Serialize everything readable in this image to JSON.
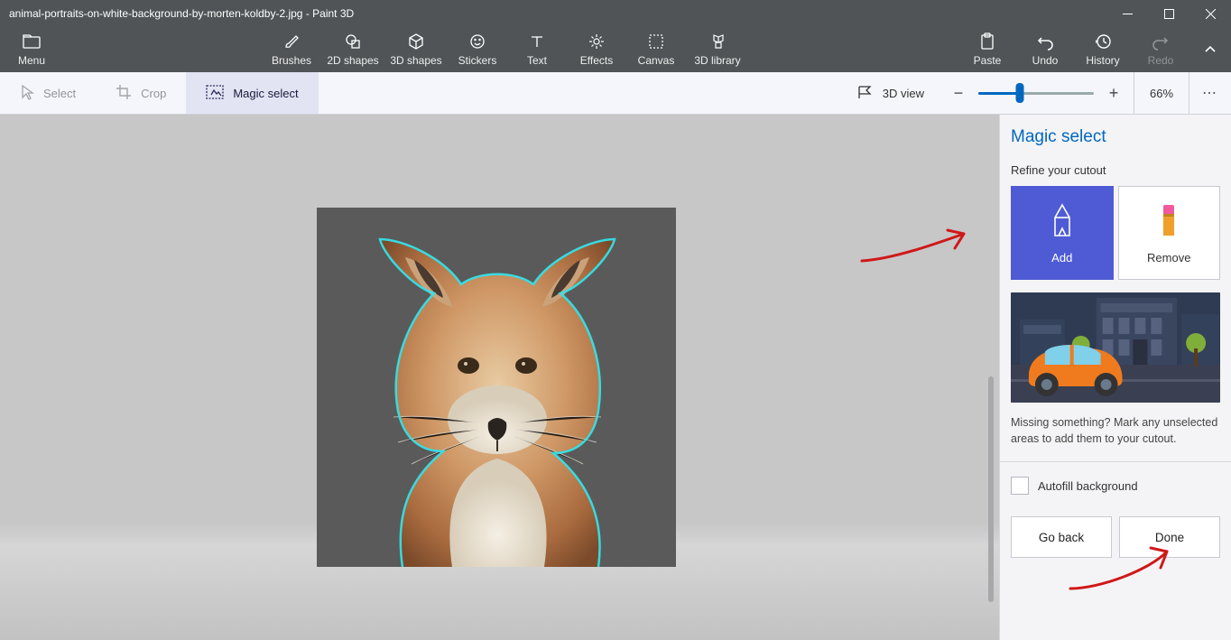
{
  "title_bar": {
    "filename": "animal-portraits-on-white-background-by-morten-koldby-2.jpg",
    "app_name": "Paint 3D"
  },
  "ribbon": {
    "menu": "Menu",
    "tools": [
      {
        "label": "Brushes",
        "icon": "brush"
      },
      {
        "label": "2D shapes",
        "icon": "shape2d"
      },
      {
        "label": "3D shapes",
        "icon": "shape3d"
      },
      {
        "label": "Stickers",
        "icon": "sticker"
      },
      {
        "label": "Text",
        "icon": "text"
      },
      {
        "label": "Effects",
        "icon": "effects"
      },
      {
        "label": "Canvas",
        "icon": "canvas"
      },
      {
        "label": "3D library",
        "icon": "library"
      }
    ],
    "right": [
      {
        "label": "Paste",
        "icon": "paste",
        "disabled": false
      },
      {
        "label": "Undo",
        "icon": "undo",
        "disabled": false
      },
      {
        "label": "History",
        "icon": "history",
        "disabled": false
      },
      {
        "label": "Redo",
        "icon": "redo",
        "disabled": true
      }
    ]
  },
  "optionsbar": {
    "select": "Select",
    "crop": "Crop",
    "magic_select": "Magic select",
    "view3d": "3D view",
    "zoom_pct": "66%"
  },
  "sidebar": {
    "title": "Magic select",
    "subhead": "Refine your cutout",
    "add": "Add",
    "remove": "Remove",
    "help": "Missing something? Mark any unselected areas to add them to your cutout.",
    "autofill": "Autofill background",
    "go_back": "Go back",
    "done": "Done"
  }
}
